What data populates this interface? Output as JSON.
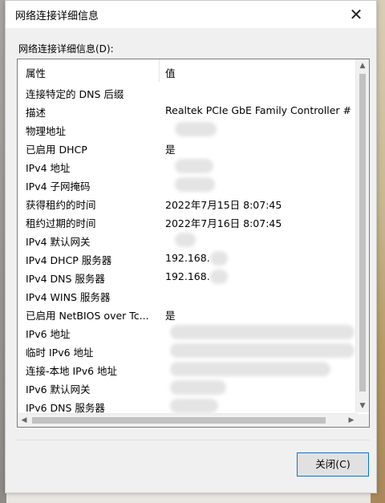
{
  "window": {
    "title": "网络连接详细信息",
    "close_glyph": "✕"
  },
  "list_label": "网络连接详细信息(D):",
  "columns": {
    "property": "属性",
    "value": "值"
  },
  "rows": [
    {
      "key": "连接特定的 DNS 后缀",
      "value": ""
    },
    {
      "key": "描述",
      "value": "Realtek PCIe GbE Family Controller #"
    },
    {
      "key": "物理地址",
      "value": ""
    },
    {
      "key": "已启用 DHCP",
      "value": "是"
    },
    {
      "key": "IPv4 地址",
      "value": ""
    },
    {
      "key": "IPv4 子网掩码",
      "value": ""
    },
    {
      "key": "获得租约的时间",
      "value": "2022年7月15日 8:07:45"
    },
    {
      "key": "租约过期的时间",
      "value": "2022年7月16日 8:07:45"
    },
    {
      "key": "IPv4 默认网关",
      "value": ""
    },
    {
      "key": "IPv4 DHCP 服务器",
      "value": "192.168."
    },
    {
      "key": "IPv4 DNS 服务器",
      "value": "192.168."
    },
    {
      "key": "IPv4 WINS 服务器",
      "value": ""
    },
    {
      "key": "已启用 NetBIOS over Tc...",
      "value": "是"
    },
    {
      "key": "IPv6 地址",
      "value": ""
    },
    {
      "key": "临时 IPv6 地址",
      "value": ""
    },
    {
      "key": "连接-本地 IPv6 地址",
      "value": ""
    },
    {
      "key": "IPv6 默认网关",
      "value": ""
    },
    {
      "key": "IPv6 DNS 服务器",
      "value": ""
    }
  ],
  "close_button": "关闭(C)"
}
